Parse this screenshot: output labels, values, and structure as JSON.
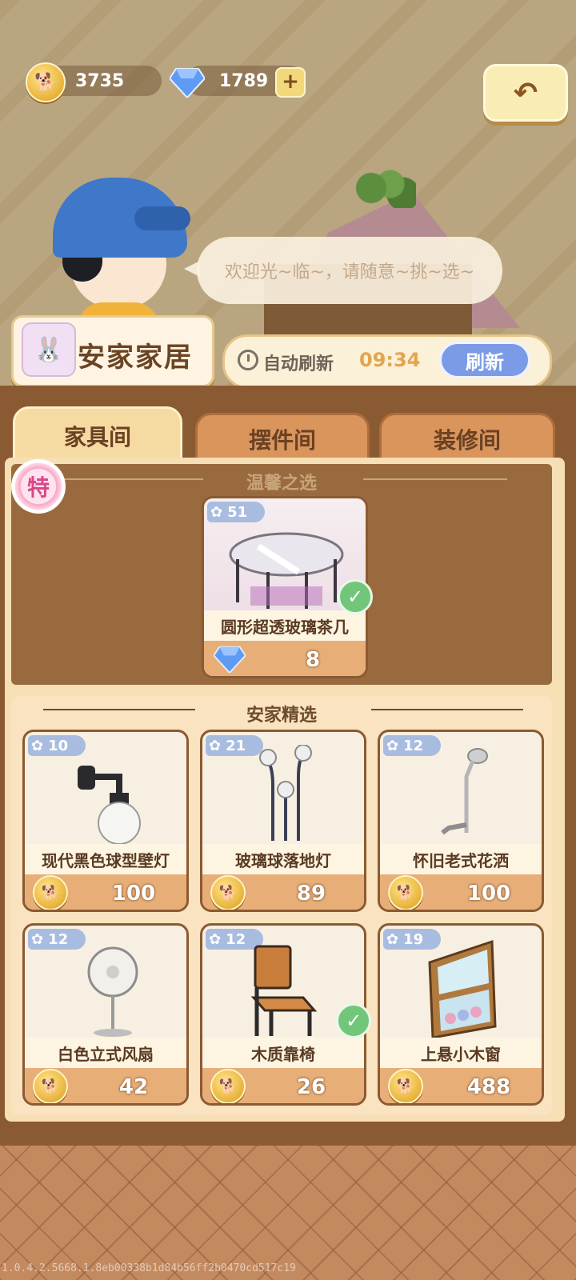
{
  "currency": {
    "coins": "3735",
    "gems": "1789",
    "coin_icon": "coin-icon",
    "gem_icon": "gem-icon"
  },
  "back_button": {
    "icon": "undo-icon",
    "glyph": "↶"
  },
  "dialog": {
    "text": "欢迎光~临~，请随意~挑~选~"
  },
  "shop": {
    "name": "安家家居"
  },
  "refresh": {
    "label": "自动刷新",
    "timer": "09:34",
    "button_label": "刷新"
  },
  "tabs": [
    {
      "label": "家具间",
      "active": true
    },
    {
      "label": "摆件间",
      "active": false
    },
    {
      "label": "装修间",
      "active": false
    }
  ],
  "special_badge": "特",
  "featured_section": {
    "title": "温馨之选",
    "item": {
      "level": "51",
      "name": "圆形超透玻璃茶几",
      "price": "8",
      "currency": "gem",
      "owned": true
    }
  },
  "catalog_section": {
    "title": "安家精选",
    "items": [
      {
        "level": "10",
        "name": "现代黑色球型壁灯",
        "price": "100",
        "currency": "coin",
        "owned": false
      },
      {
        "level": "21",
        "name": "玻璃球落地灯",
        "price": "89",
        "currency": "coin",
        "owned": false
      },
      {
        "level": "12",
        "name": "怀旧老式花洒",
        "price": "100",
        "currency": "coin",
        "owned": false
      },
      {
        "level": "12",
        "name": "白色立式风扇",
        "price": "42",
        "currency": "coin",
        "owned": false
      },
      {
        "level": "12",
        "name": "木质靠椅",
        "price": "26",
        "currency": "coin",
        "owned": true
      },
      {
        "level": "19",
        "name": "上悬小木窗",
        "price": "488",
        "currency": "coin",
        "owned": false
      }
    ]
  },
  "footer": "1.0.4.2.5668.1.8eb00338b1d84b56ff2b0470cd517c19",
  "colors": {
    "panel": "#f6dfb4",
    "wood": "#8a5a33",
    "accent_blue": "#7c9be6",
    "coin": "#e9b23b"
  }
}
